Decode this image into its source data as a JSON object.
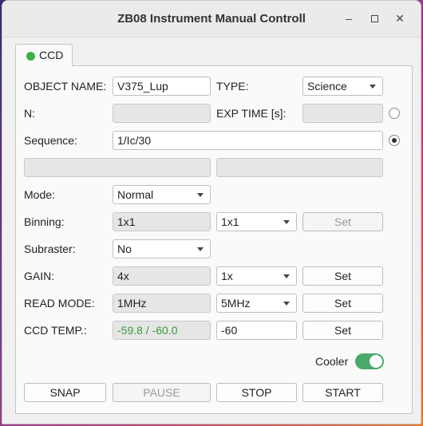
{
  "window": {
    "title": "ZB08 Instrument Manual Controll",
    "minimize_glyph": "–",
    "close_glyph": "✕"
  },
  "tab": {
    "label": "CCD",
    "status_color": "#3bb143"
  },
  "form": {
    "object_name": {
      "label": "OBJECT NAME:",
      "value": "V375_Lup"
    },
    "type": {
      "label": "TYPE:",
      "value": "Science"
    },
    "n": {
      "label": "N:",
      "value": ""
    },
    "exp_time": {
      "label": "EXP TIME [s]:",
      "value": "",
      "radio_checked": false
    },
    "sequence": {
      "label": "Sequence:",
      "value": "1/Ic/30",
      "radio_checked": true
    },
    "extra_left": {
      "value": ""
    },
    "extra_right": {
      "value": ""
    },
    "mode": {
      "label": "Mode:",
      "value": "Normal"
    },
    "binning": {
      "label": "Binning:",
      "current": "1x1",
      "select": "1x1",
      "set_label": "Set"
    },
    "subraster": {
      "label": "Subraster:",
      "value": "No"
    },
    "gain": {
      "label": "GAIN:",
      "current": "4x",
      "select": "1x",
      "set_label": "Set"
    },
    "read_mode": {
      "label": "READ MODE:",
      "current": "1MHz",
      "select": "5MHz",
      "set_label": "Set"
    },
    "ccd_temp": {
      "label": "CCD TEMP.:",
      "current": "-59.8 / -60.0",
      "target": "-60",
      "set_label": "Set"
    },
    "cooler": {
      "label": "Cooler",
      "on": true
    }
  },
  "actions": {
    "snap": "SNAP",
    "pause": "PAUSE",
    "stop": "STOP",
    "start": "START"
  }
}
